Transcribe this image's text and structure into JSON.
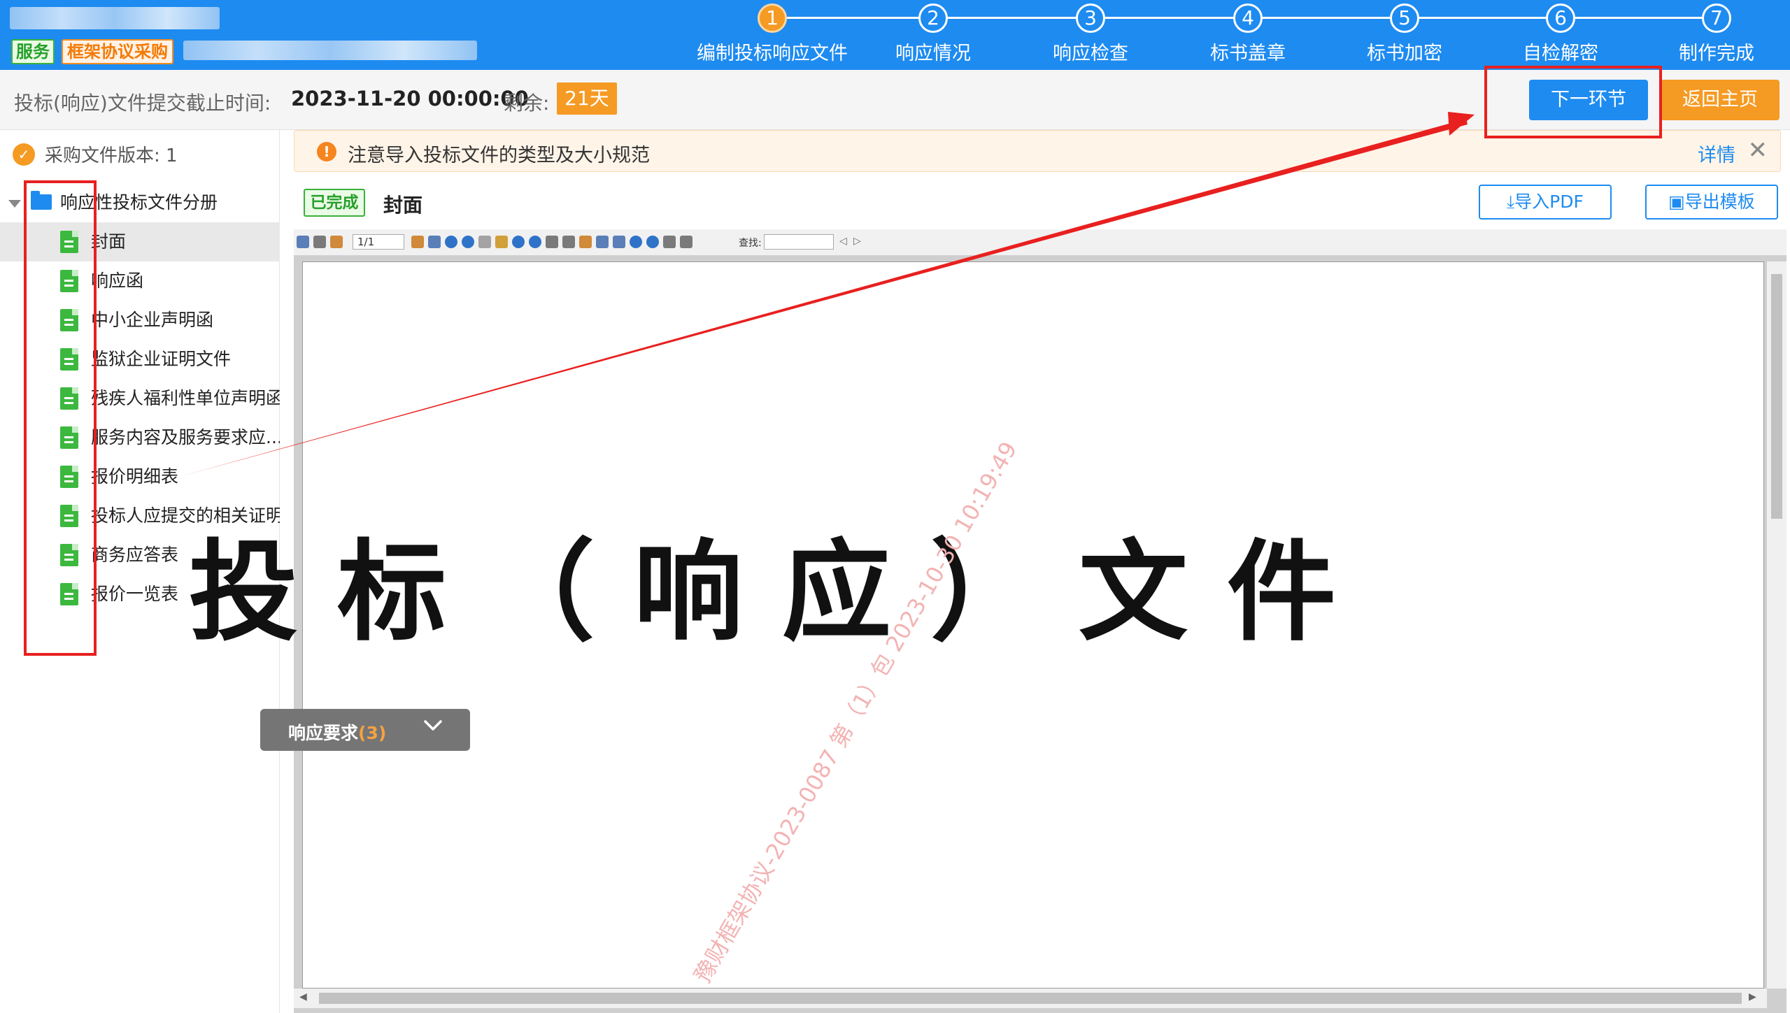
{
  "header": {
    "tags": {
      "service": "服务",
      "framework": "框架协议采购"
    },
    "steps": [
      {
        "num": "1",
        "label": "编制投标响应文件",
        "active": true
      },
      {
        "num": "2",
        "label": "响应情况",
        "active": false
      },
      {
        "num": "3",
        "label": "响应检查",
        "active": false
      },
      {
        "num": "4",
        "label": "标书盖章",
        "active": false
      },
      {
        "num": "5",
        "label": "标书加密",
        "active": false
      },
      {
        "num": "6",
        "label": "自检解密",
        "active": false
      },
      {
        "num": "7",
        "label": "制作完成",
        "active": false
      }
    ]
  },
  "deadline": {
    "label": "投标(响应)文件提交截止时间:",
    "date": "2023-11-20 00:00:00",
    "remain_label": "剩余:",
    "remain_days": "21天",
    "next_button": "下一环节",
    "home_button": "返回主页"
  },
  "sidebar": {
    "version_label": "采购文件版本: 1",
    "version_icon": "v-badge-icon",
    "root": "响应性投标文件分册",
    "items": [
      {
        "label": "封面",
        "selected": true
      },
      {
        "label": "响应函"
      },
      {
        "label": "中小企业声明函"
      },
      {
        "label": "监狱企业证明文件"
      },
      {
        "label": "残疾人福利性单位声明函"
      },
      {
        "label": "服务内容及服务要求应..."
      },
      {
        "label": "报价明细表"
      },
      {
        "label": "投标人应提交的相关证明"
      },
      {
        "label": "商务应答表"
      },
      {
        "label": "报价一览表"
      }
    ]
  },
  "notice": {
    "text": "注意导入投标文件的类型及大小规范",
    "detail": "详情",
    "close": "✕"
  },
  "document": {
    "status": "已完成",
    "title": "封面",
    "import_pdf": "导入PDF",
    "export_template": "导出模板"
  },
  "viewer": {
    "page_field": "1/1",
    "search_label": "查找:",
    "cover_title": "投标（响应）文件",
    "watermark": "豫财框架协议-2023-0087 第（1）包 2023-10-30 10:19:49"
  },
  "requirements": {
    "label": "响应要求",
    "count": "(3)"
  },
  "colors": {
    "primary": "#1e8bf0",
    "accent": "#f59a23",
    "success": "#39b13a",
    "annotation": "#e8201f"
  }
}
